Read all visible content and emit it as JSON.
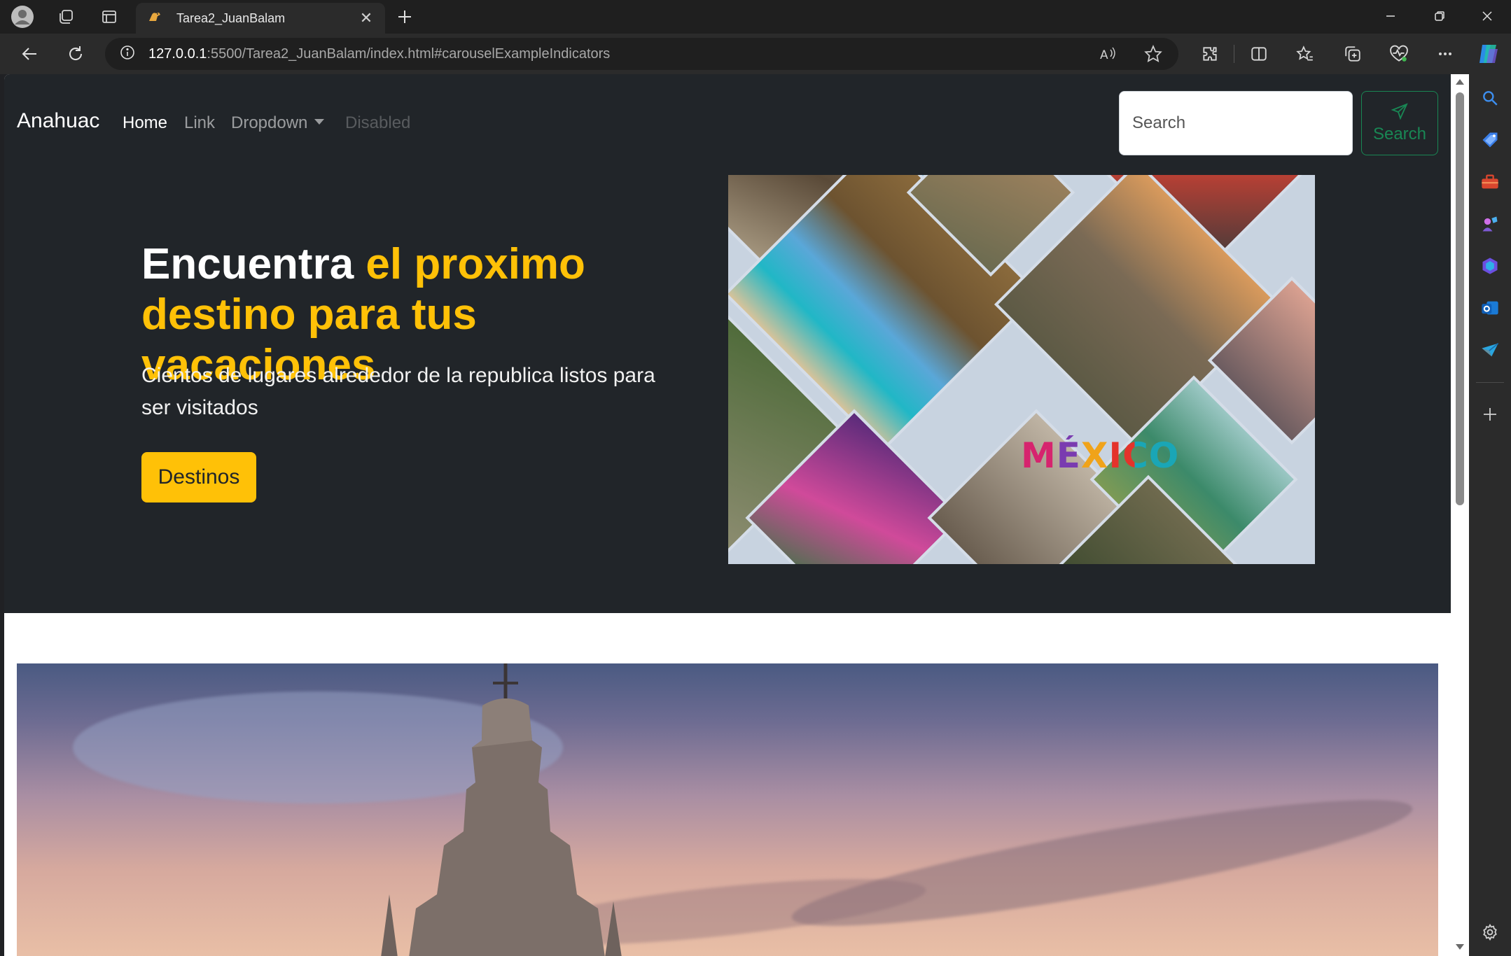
{
  "browser": {
    "tab_title": "Tarea2_JuanBalam",
    "url_host": "127.0.0.1",
    "url_rest": ":5500/Tarea2_JuanBalam/index.html#carouselExampleIndicators",
    "icons": [
      "profile-icon",
      "workspaces-icon",
      "tab-actions-icon",
      "tab-favicon",
      "close-tab-icon",
      "new-tab-icon",
      "minimize-icon",
      "restore-icon",
      "close-window-icon",
      "back-icon",
      "refresh-icon",
      "site-info-icon",
      "read-aloud-icon",
      "favorite-star-icon",
      "extensions-icon",
      "split-screen-icon",
      "favorites-icon",
      "collections-icon",
      "browser-essentials-icon",
      "more-icon",
      "copilot-icon",
      "search-sidebar-icon",
      "tag-icon",
      "toolbox-icon",
      "games-icon",
      "microsoft-365-icon",
      "outlook-icon",
      "send-icon",
      "add-sidebar-icon",
      "settings-icon"
    ]
  },
  "navbar": {
    "brand": "Anahuac",
    "links": [
      {
        "label": "Home",
        "state": "active"
      },
      {
        "label": "Link",
        "state": "normal"
      },
      {
        "label": "Dropdown",
        "state": "normal"
      },
      {
        "label": "Disabled",
        "state": "disabled"
      }
    ],
    "search_placeholder": "Search",
    "search_button": "Search"
  },
  "hero": {
    "headline_white": "Encuentra ",
    "headline_yellow": "el proximo destino para tus vacaciones",
    "lead": "Cientos de lugares alrededor de la republica listos para ser visitados",
    "cta": "Destinos",
    "image_text": "MÉXICO"
  },
  "colors": {
    "navbar_bg": "#212529",
    "accent_yellow": "#ffc107",
    "success_green": "#198754"
  }
}
